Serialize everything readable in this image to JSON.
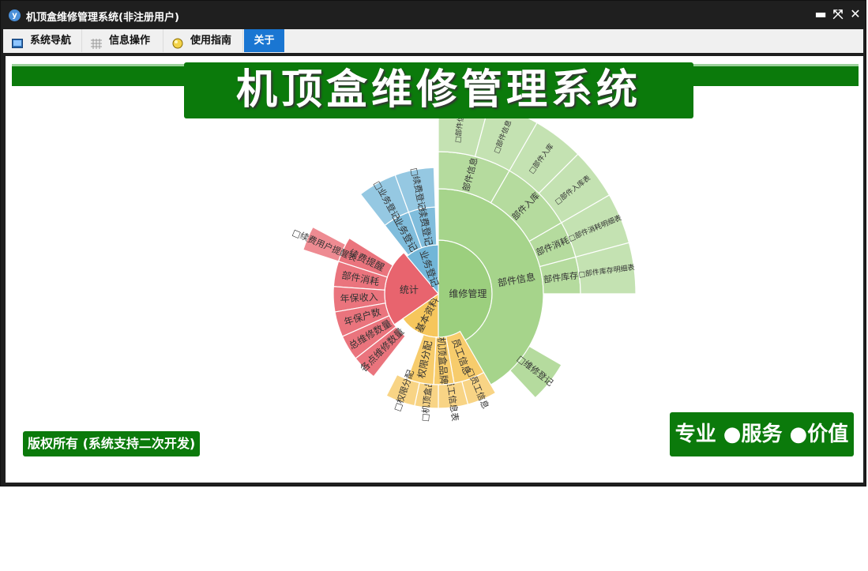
{
  "window": {
    "title": "机顶盒维修管理系统(非注册用户)"
  },
  "titlebar_buttons": {
    "minimize": "▬",
    "restore": "⤧",
    "close": "✕"
  },
  "menu": {
    "tabs": [
      {
        "label": "系统导航",
        "icon": "monitor-icon"
      },
      {
        "label": "信息操作",
        "icon": "grid-icon"
      },
      {
        "label": "使用指南",
        "icon": "lightbulb-icon"
      },
      {
        "label": "关于"
      }
    ],
    "active_tab": "关于"
  },
  "main": {
    "banner": "机顶盒维修管理系统",
    "copyright": "版权所有 (系统支持二次开发)",
    "slogan": "专业 ●服务 ●价值"
  },
  "chart_data": {
    "type": "sunburst",
    "colors": {
      "维修管理": "#9ccf7e",
      "基本资料": "#f6c65c",
      "统计": "#e8646e",
      "业务登记": "#72b6d8"
    },
    "tree": [
      {
        "name": "维修管理",
        "children": [
          {
            "name": "部件信息",
            "children": [
              {
                "name": "部件信息",
                "children": [
                  {
                    "name": "□部件信息"
                  },
                  {
                    "name": "□部件信息"
                  }
                ]
              },
              {
                "name": "部件入库",
                "children": [
                  {
                    "name": "□部件入库"
                  },
                  {
                    "name": "□部件入库表"
                  }
                ]
              },
              {
                "name": "部件消耗",
                "children": [
                  {
                    "name": "□部件消耗明细表"
                  }
                ]
              },
              {
                "name": "部件库存",
                "children": [
                  {
                    "name": "□部件库存明细表"
                  }
                ]
              }
            ]
          },
          {
            "name": "维修登记",
            "children": [
              {
                "name": "□维修登记"
              }
            ]
          }
        ]
      },
      {
        "name": "基本资料",
        "children": [
          {
            "name": "员工信息",
            "children": [
              {
                "name": "□员工信息"
              },
              {
                "name": "□员工信息表"
              }
            ]
          },
          {
            "name": "机顶盒品牌",
            "children": [
              {
                "name": "□机顶盒品牌"
              }
            ]
          },
          {
            "name": "权限分配",
            "children": [
              {
                "name": "□权限分配"
              }
            ]
          }
        ]
      },
      {
        "name": "统计",
        "children": [
          {
            "name": "续费提醒",
            "children": [
              {
                "name": "□续费用户提醒表"
              }
            ]
          },
          {
            "name": "部件消耗"
          },
          {
            "name": "年保收入"
          },
          {
            "name": "年保户数"
          },
          {
            "name": "总维修数量"
          },
          {
            "name": "各点维修数量"
          }
        ]
      },
      {
        "name": "业务登记",
        "children": [
          {
            "name": "业务登记",
            "children": [
              {
                "name": "□业务登记"
              }
            ]
          },
          {
            "name": "续费登记",
            "children": [
              {
                "name": "□续费登记"
              }
            ]
          }
        ]
      }
    ]
  }
}
